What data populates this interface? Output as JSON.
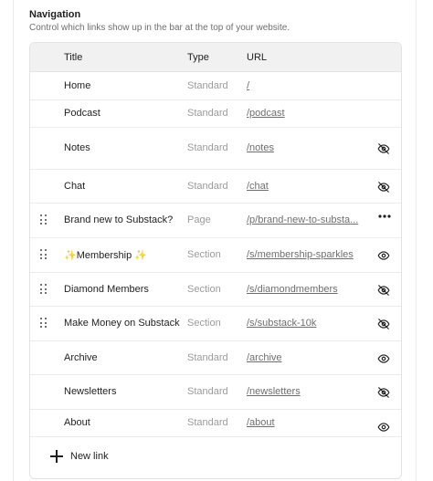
{
  "section": {
    "title": "Navigation",
    "description": "Control which links show up in the bar at the top of your website."
  },
  "table": {
    "headers": {
      "title": "Title",
      "type": "Type",
      "url": "URL"
    },
    "rows": [
      {
        "title": "Home",
        "type": "Standard",
        "url": "/",
        "draggable": false,
        "action_icon": "none"
      },
      {
        "title": "Podcast",
        "type": "Standard",
        "url": "/podcast",
        "draggable": false,
        "action_icon": "none"
      },
      {
        "title": "Notes",
        "type": "Standard",
        "url": "/notes",
        "draggable": false,
        "action_icon": "eye-off-icon"
      },
      {
        "title": "Chat",
        "type": "Standard",
        "url": "/chat",
        "draggable": false,
        "action_icon": "eye-off-icon"
      },
      {
        "title": "Brand new to Substack?",
        "type": "Page",
        "url": "/p/brand-new-to-substa...",
        "draggable": true,
        "action_icon": "more-icon"
      },
      {
        "title": "✨Membership ✨",
        "type": "Section",
        "url": "/s/membership-sparkles",
        "draggable": true,
        "action_icon": "eye-icon"
      },
      {
        "title": "Diamond Members",
        "type": "Section",
        "url": "/s/diamondmembers",
        "draggable": true,
        "action_icon": "eye-off-icon"
      },
      {
        "title": "Make Money on Substack",
        "type": "Section",
        "url": "/s/substack-10k",
        "draggable": true,
        "action_icon": "eye-off-icon"
      },
      {
        "title": "Archive",
        "type": "Standard",
        "url": "/archive",
        "draggable": false,
        "action_icon": "eye-icon"
      },
      {
        "title": "Newsletters",
        "type": "Standard",
        "url": "/newsletters",
        "draggable": false,
        "action_icon": "eye-off-icon"
      },
      {
        "title": "About",
        "type": "Standard",
        "url": "/about",
        "draggable": false,
        "action_icon": "eye-icon"
      }
    ]
  },
  "new_link_label": "New link"
}
